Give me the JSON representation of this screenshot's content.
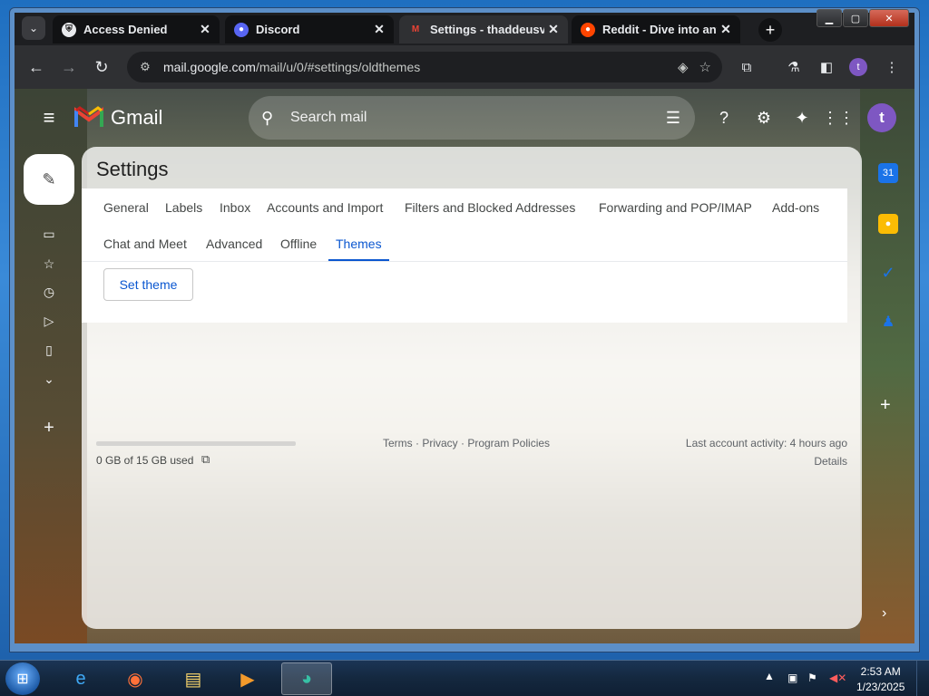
{
  "browser": {
    "tabs": [
      {
        "title": "Access Denied",
        "icon": "shield-icon",
        "active": false
      },
      {
        "title": "Discord",
        "icon": "discord-icon",
        "active": false
      },
      {
        "title": "Settings - thaddeusvw",
        "icon": "gmail-icon",
        "active": true
      },
      {
        "title": "Reddit - Dive into any",
        "icon": "reddit-icon",
        "active": false
      }
    ],
    "url_host": "mail.google.com",
    "url_path": "/mail/u/0/#settings/oldthemes",
    "profile_initial": "t"
  },
  "gmail": {
    "logo_text": "Gmail",
    "search_placeholder": "Search mail",
    "avatar_initial": "t",
    "settings_title": "Settings",
    "settings_tabs_row1": [
      "General",
      "Labels",
      "Inbox",
      "Accounts and Import",
      "Filters and Blocked Addresses",
      "Forwarding and POP/IMAP",
      "Add-ons"
    ],
    "settings_tabs_row2": [
      "Chat and Meet",
      "Advanced",
      "Offline",
      "Themes"
    ],
    "active_tab": "Themes",
    "set_theme_label": "Set theme",
    "storage_text": "0 GB of 15 GB used",
    "storage_used_fraction": 0.0,
    "footer_links": "Terms · Privacy · Program Policies",
    "last_activity": "Last account activity: 4 hours ago",
    "details_link": "Details"
  },
  "taskbar": {
    "time": "2:53 AM",
    "date": "1/23/2025"
  }
}
